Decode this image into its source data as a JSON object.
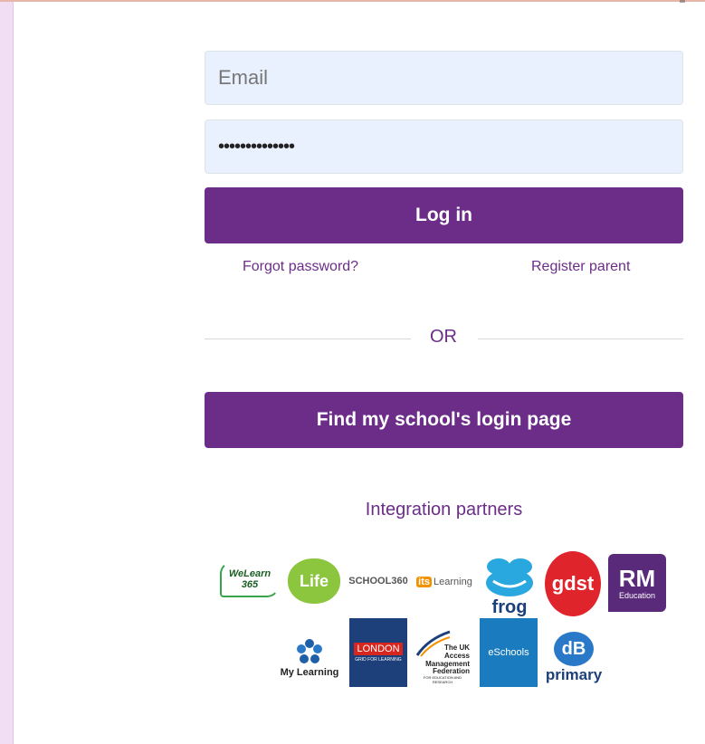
{
  "form": {
    "email_placeholder": "Email",
    "password_value": "••••••••••••••",
    "login_label": "Log in",
    "forgot_label": "Forgot password?",
    "register_label": "Register parent",
    "or_label": "OR",
    "school_login_label": "Find my school's login page"
  },
  "partners": {
    "heading": "Integration partners",
    "logos": {
      "welearn": "WeLearn 365",
      "life": "Life",
      "school360": "SCHOOL360",
      "itslearning_badge": "its",
      "itslearning": "Learning",
      "frog": "frog",
      "gdst": "gdst",
      "rm": "RM",
      "rm_sub": "Education",
      "mylearning": "My Learning",
      "london": "LONDON",
      "london_sub": "GRID FOR LEARNING",
      "ukfed_1": "The UK",
      "ukfed_2": "Access",
      "ukfed_3": "Management",
      "ukfed_4": "Federation",
      "ukfed_5": "FOR EDUCATION AND RESEARCH",
      "eschools": "eSchools",
      "primary_top": "dB",
      "primary": "primary"
    }
  },
  "colors": {
    "brand": "#6c2d88",
    "input_bg": "#e9f0fe"
  }
}
